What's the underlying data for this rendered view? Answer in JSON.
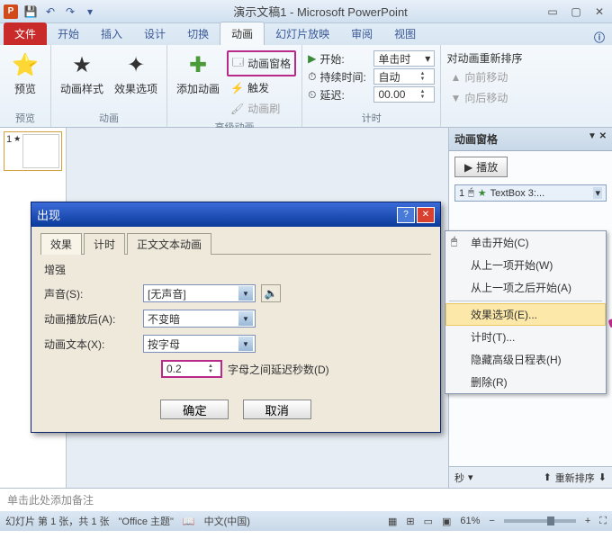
{
  "app": {
    "title": "演示文稿1 - Microsoft PowerPoint",
    "icon_letter": "P"
  },
  "tabs": {
    "file": "文件",
    "home": "开始",
    "insert": "插入",
    "design": "设计",
    "transitions": "切换",
    "animations": "动画",
    "slideshow": "幻灯片放映",
    "review": "审阅",
    "view": "视图"
  },
  "ribbon": {
    "preview_btn": "预览",
    "preview_group": "预览",
    "anim_styles": "动画样式",
    "effect_options": "效果选项",
    "animation_group": "动画",
    "add_anim": "添加动画",
    "anim_pane_btn": "动画窗格",
    "trigger": "触发",
    "anim_painter": "动画刷",
    "advanced_group": "高级动画",
    "start_label": "开始:",
    "start_value": "单击时",
    "duration_label": "持续时间:",
    "duration_value": "自动",
    "delay_label": "延迟:",
    "delay_value": "00.00",
    "reorder_label": "对动画重新排序",
    "move_earlier": "向前移动",
    "move_later": "向后移动",
    "timing_group": "计时"
  },
  "anim_pane": {
    "title": "动画窗格",
    "play": "播放",
    "item_num": "1",
    "item_text": "TextBox 3:...",
    "seconds": "秒",
    "reorder": "重新排序"
  },
  "context_menu": {
    "on_click": "单击开始(C)",
    "with_prev": "从上一项开始(W)",
    "after_prev": "从上一项之后开始(A)",
    "effect_options": "效果选项(E)...",
    "timing": "计时(T)...",
    "hide_timeline": "隐藏高级日程表(H)",
    "remove": "删除(R)"
  },
  "dialog": {
    "title": "出现",
    "tab_effect": "效果",
    "tab_timing": "计时",
    "tab_text": "正文文本动画",
    "section": "增强",
    "sound_label": "声音(S):",
    "sound_value": "[无声音]",
    "after_label": "动画播放后(A):",
    "after_value": "不变暗",
    "text_label": "动画文本(X):",
    "text_value": "按字母",
    "delay_value": "0.2",
    "delay_suffix": "字母之间延迟秒数(D)",
    "ok": "确定",
    "cancel": "取消"
  },
  "thumb": {
    "num": "1"
  },
  "notes": {
    "placeholder": "单击此处添加备注"
  },
  "status": {
    "slide_info": "幻灯片 第 1 张，共 1 张",
    "theme": "\"Office 主题\"",
    "lang": "中文(中国)",
    "zoom": "61%"
  }
}
